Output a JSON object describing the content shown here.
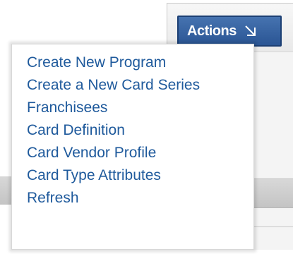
{
  "actions_button": {
    "label": "Actions",
    "icon": "arrow-down-right-icon"
  },
  "menu": {
    "items": [
      {
        "label": "Create New Program"
      },
      {
        "label": "Create a New Card Series"
      },
      {
        "label": "Franchisees"
      },
      {
        "label": "Card Definition"
      },
      {
        "label": "Card Vendor Profile"
      },
      {
        "label": "Card Type Attributes"
      },
      {
        "label": "Refresh"
      }
    ]
  },
  "colors": {
    "button_bg": "#2f5c9c",
    "link": "#1f5a9c"
  }
}
